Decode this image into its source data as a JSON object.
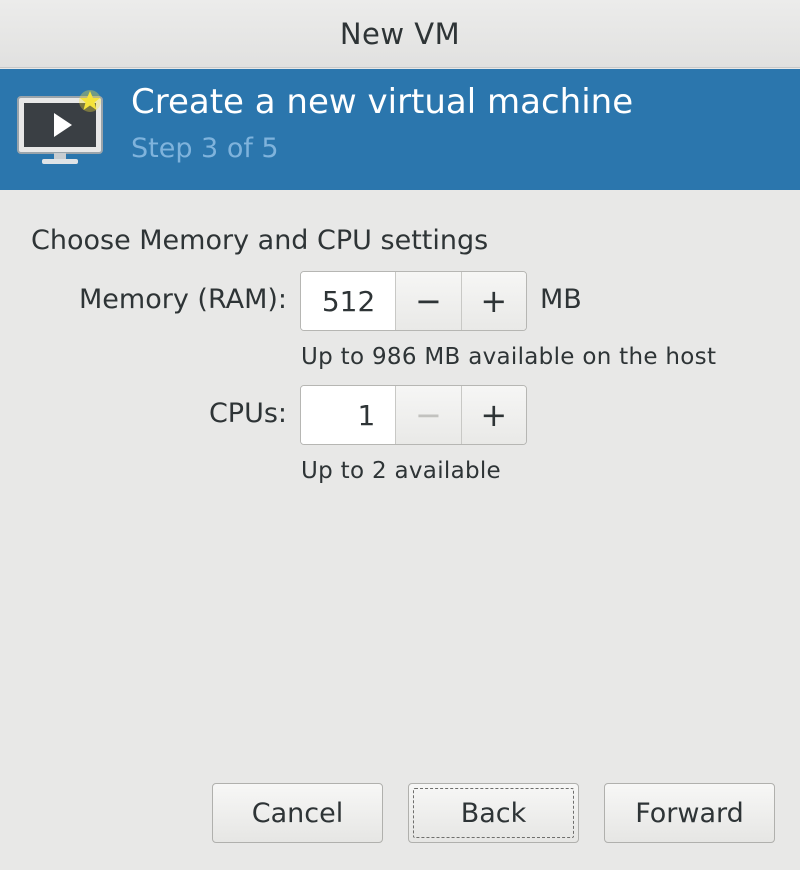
{
  "window": {
    "title": "New VM"
  },
  "banner": {
    "title": "Create a new virtual machine",
    "step": "Step 3 of 5",
    "icon": "monitor-play-icon",
    "colors": {
      "background": "#2b76ad",
      "step_text": "#7fb3dc",
      "star": "#f5e33a"
    }
  },
  "section": {
    "heading": "Choose Memory and CPU settings"
  },
  "memory": {
    "label": "Memory (RAM):",
    "value": "512",
    "unit": "MB",
    "decrement_label": "−",
    "increment_label": "+",
    "hint": "Up to 986 MB available on the host"
  },
  "cpus": {
    "label": "CPUs:",
    "value": "1",
    "decrement_label": "−",
    "increment_label": "+",
    "decrement_disabled": true,
    "hint": "Up to 2 available"
  },
  "buttons": {
    "cancel": "Cancel",
    "back": "Back",
    "forward": "Forward"
  }
}
